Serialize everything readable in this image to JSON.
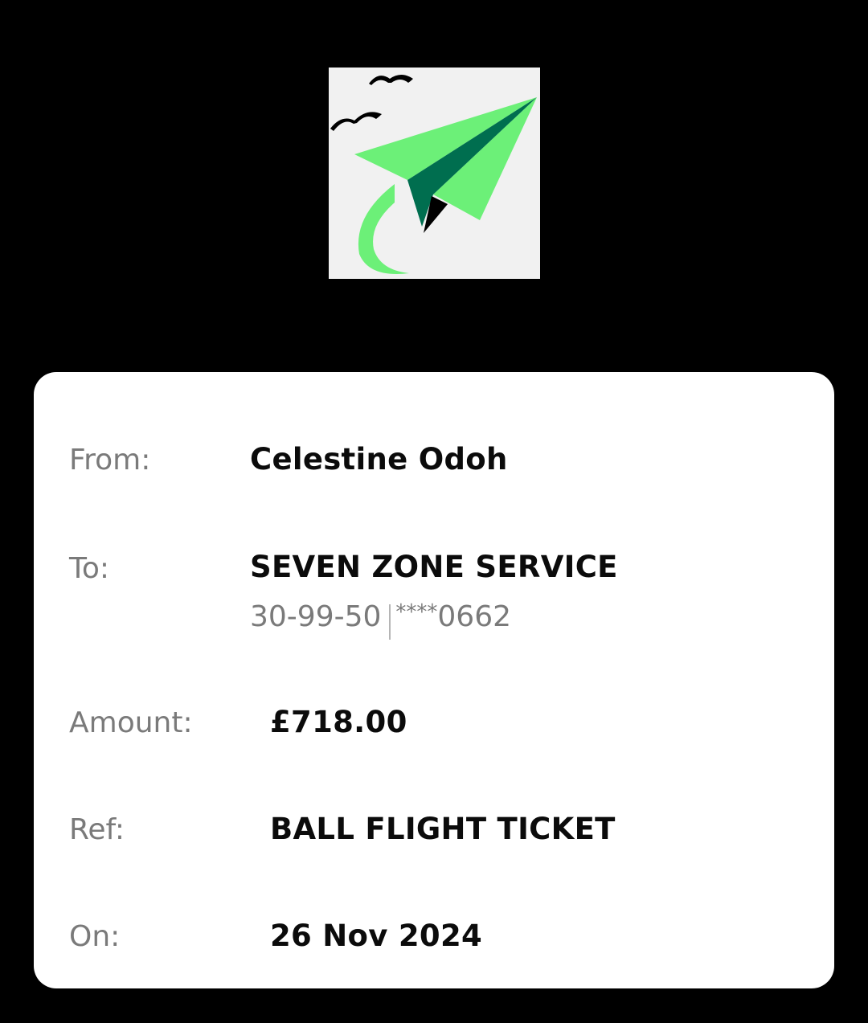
{
  "logo": {
    "icon": "paper-plane-logo",
    "colors": {
      "background": "#f1f1f1",
      "plane_light": "#6cf078",
      "plane_dark": "#006e4f",
      "birds": "#000000"
    }
  },
  "details": {
    "from": {
      "label": "From:",
      "value": "Celestine Odoh"
    },
    "to": {
      "label": "To:",
      "value": "SEVEN ZONE SERVICE",
      "sort_code": "30-99-50",
      "account_stars": "****",
      "account_last4": "0662"
    },
    "amount": {
      "label": "Amount:",
      "value": "£718.00"
    },
    "ref": {
      "label": "Ref:",
      "value": "BALL FLIGHT TICKET"
    },
    "on": {
      "label": "On:",
      "value": "26 Nov 2024"
    }
  }
}
